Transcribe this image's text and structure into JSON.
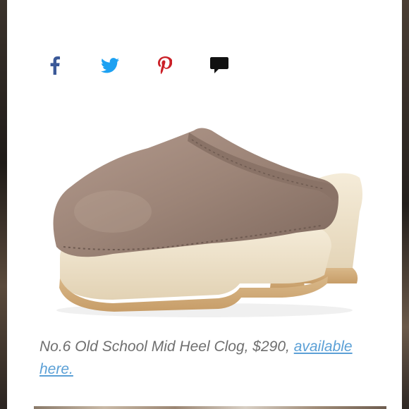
{
  "share": {
    "facebook": {
      "icon": "facebook-icon",
      "color": "#3b5998"
    },
    "twitter": {
      "icon": "twitter-icon",
      "color": "#1da1f2"
    },
    "pinterest": {
      "icon": "pinterest-icon",
      "color": "#cb2027"
    },
    "comment": {
      "icon": "comment-icon",
      "color": "#111111"
    }
  },
  "product": {
    "image_icon": "clog-shoe-image",
    "caption_text": "No.6 Old School Mid Heel Clog, $290, ",
    "link_text": "available here."
  },
  "colors": {
    "caption": "#6f6f6f",
    "link": "#5ba0d6",
    "suede": "#9c8578",
    "wood": "#efe3cc"
  }
}
